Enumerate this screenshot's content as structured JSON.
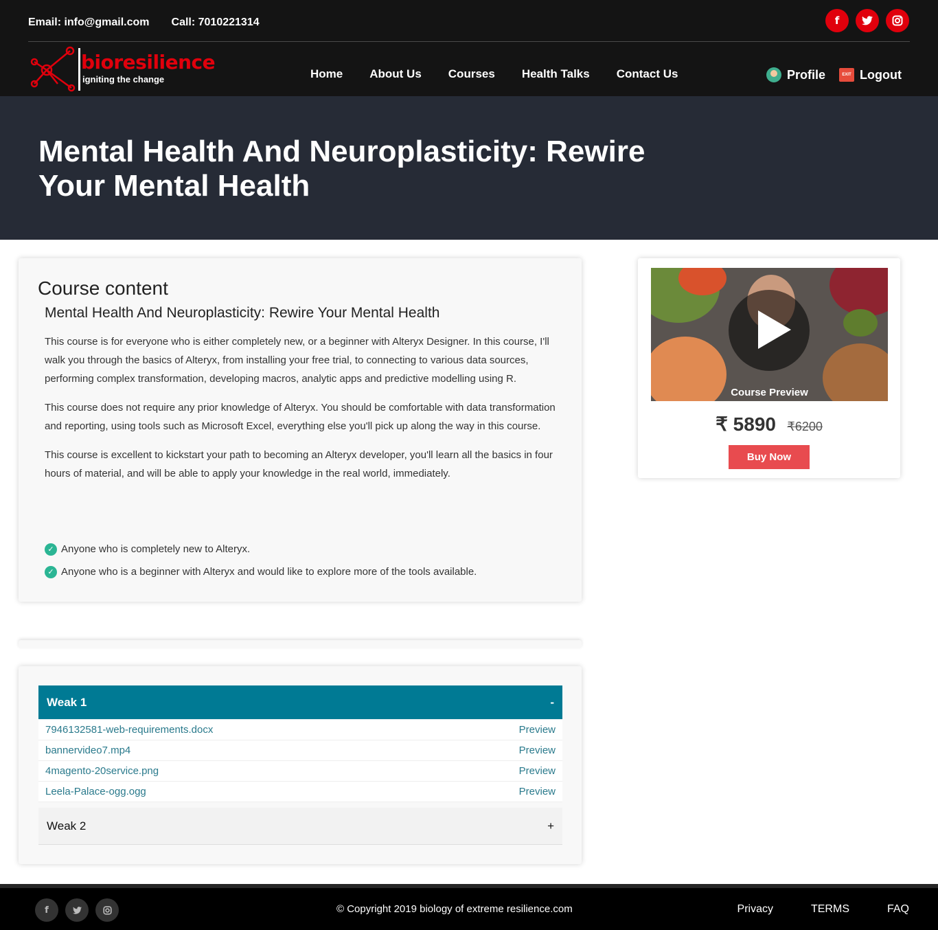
{
  "header": {
    "email": "Email: info@gmail.com",
    "phone": "Call: 7010221314",
    "social_icons": [
      "facebook-icon",
      "twitter-icon",
      "instagram-icon"
    ],
    "logo_word": "bioresilience",
    "logo_tagline": "igniting the change",
    "nav": [
      "Home",
      "About Us",
      "Courses",
      "Health Talks",
      "Contact Us"
    ],
    "profile": "Profile",
    "logout": "Logout",
    "exit_badge": "EXIT"
  },
  "hero": {
    "title": "Mental Health And Neuroplasticity: Rewire Your Mental Health"
  },
  "content": {
    "heading": "Course content",
    "subtitle": "Mental Health And Neuroplasticity: Rewire Your Mental Health",
    "paragraphs": [
      "This course is for everyone who is either completely new, or a beginner with Alteryx Designer. In this course, I'll walk you through the basics of Alteryx, from installing your free trial, to connecting to various data sources, performing complex transformation, developing macros, analytic apps and predictive modelling using R.",
      "This course does not require any prior knowledge of Alteryx. You should be comfortable with data transformation and reporting, using tools such as Microsoft Excel, everything else you'll pick up along the way in this course.",
      "This course is excellent to kickstart your path to becoming an Alteryx developer, you'll learn all the basics in four hours of material, and will be able to apply your knowledge in the real world, immediately."
    ],
    "checks": [
      "Anyone who is completely new to Alteryx.",
      "Anyone who is a beginner with Alteryx and would like to explore more of the tools available."
    ]
  },
  "weeks": {
    "week1": {
      "label": "Weak 1",
      "toggle": "-"
    },
    "files": [
      {
        "name": "7946132581-web-requirements.docx",
        "action": "Preview"
      },
      {
        "name": "bannervideo7.mp4",
        "action": "Preview"
      },
      {
        "name": "4magento-20service.png",
        "action": "Preview"
      },
      {
        "name": "Leela-Palace-ogg.ogg",
        "action": "Preview"
      }
    ],
    "week2": {
      "label": "Weak 2",
      "toggle": "+"
    }
  },
  "preview": {
    "label": "Course Preview",
    "currency": "₹",
    "price": "5890",
    "old_price": "6200",
    "buy": "Buy Now"
  },
  "footer": {
    "copyright": "© Copyright 2019 biology of extreme resilience.com",
    "links": [
      "Privacy",
      "TERMS",
      "FAQ"
    ]
  },
  "colors": {
    "brand_red": "#e0000c",
    "hero_bg": "#262b36",
    "week_header": "#007a94",
    "buy_button": "#e84b4f",
    "check_green": "#2bb594"
  }
}
